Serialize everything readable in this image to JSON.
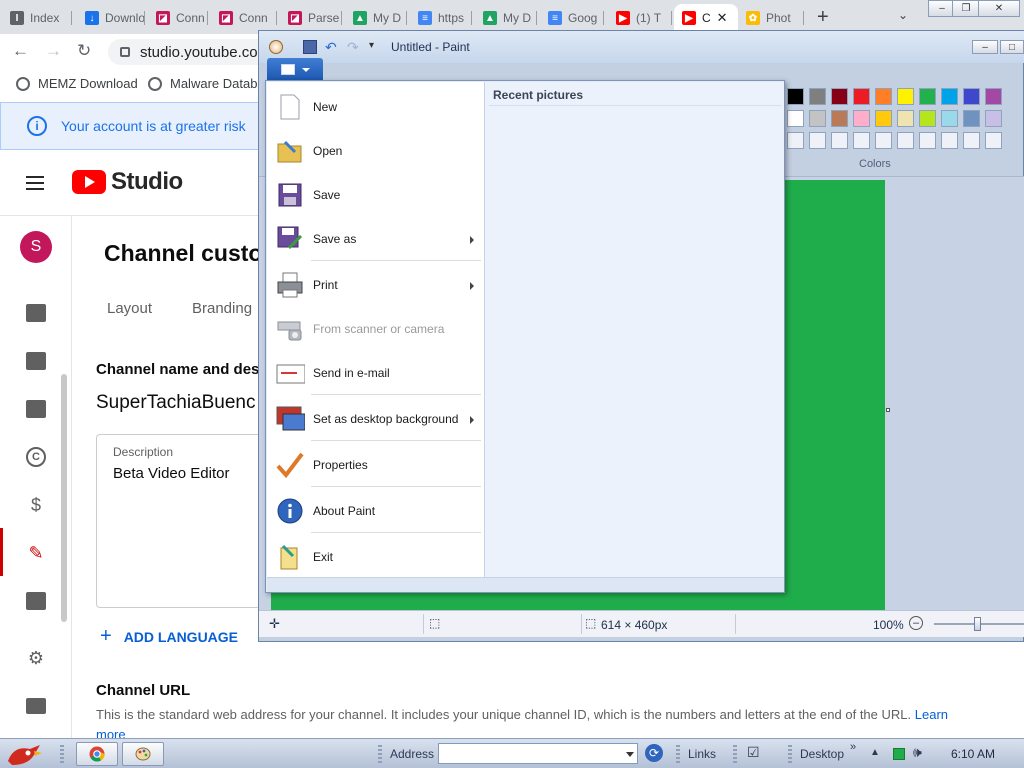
{
  "browser": {
    "tabs": [
      {
        "label": "Index",
        "fav": "I",
        "favColor": "#5f6368"
      },
      {
        "label": "Downloads",
        "fav": "↓",
        "favColor": "#1a73e8"
      },
      {
        "label": "Conn",
        "fav": "◪",
        "favColor": "#c2185b"
      },
      {
        "label": "Conn",
        "fav": "◪",
        "favColor": "#c2185b"
      },
      {
        "label": "Parse",
        "fav": "◪",
        "favColor": "#c2185b"
      },
      {
        "label": "My D",
        "fav": "▲",
        "favColor": "#1fa463"
      },
      {
        "label": "https",
        "fav": "≡",
        "favColor": "#4285f4"
      },
      {
        "label": "My D",
        "fav": "▲",
        "favColor": "#1fa463"
      },
      {
        "label": "Goog",
        "fav": "≡",
        "favColor": "#4285f4"
      },
      {
        "label": "(1) T",
        "fav": "▶",
        "favColor": "#ff0000"
      },
      {
        "label": "C",
        "fav": "▶",
        "favColor": "#ff0000"
      },
      {
        "label": "Phot",
        "fav": "✿",
        "favColor": "#fbbc04"
      }
    ],
    "new_tab": "+",
    "address": "studio.youtube.com",
    "bookmarks": [
      "MEMZ Download",
      "Malware Databas"
    ]
  },
  "youtube": {
    "banner": "Your account is at greater risk",
    "logo_text": "Studio",
    "avatar_letter": "S",
    "page_title": "Channel custom",
    "tabs": [
      "Layout",
      "Branding"
    ],
    "section_title": "Channel name and desc",
    "channel_name": "SuperTachiaBuenc",
    "description_label": "Description",
    "description_value": "Beta Video Editor",
    "add_language": "ADD LANGUAGE",
    "url_title": "Channel URL",
    "url_desc": "This is the standard web address for your channel. It includes your unique channel ID, which is the numbers and letters at the end of the URL.",
    "learn_more": "Learn more"
  },
  "paint": {
    "title": "Untitled - Paint",
    "colors_label": "Colors",
    "palette_row1": [
      "#000000",
      "#7f7f7f",
      "#880015",
      "#ed1c24",
      "#ff7f27",
      "#fff200",
      "#22b14c",
      "#00a2e8",
      "#3f48cc",
      "#a349a4"
    ],
    "palette_row2": [
      "#ffffff",
      "#c3c3c3",
      "#b97a57",
      "#ffaec9",
      "#ffc90e",
      "#efe4b0",
      "#b5e61d",
      "#99d9ea",
      "#7092be",
      "#c8bfe7"
    ],
    "canvas_color": "#1fad4b",
    "dimensions": "614 × 460px",
    "zoom": "100%",
    "menu": {
      "recent_label": "Recent pictures",
      "items": [
        {
          "label": "New",
          "icon": "new-doc-icon"
        },
        {
          "label": "Open",
          "icon": "folder-open-icon"
        },
        {
          "label": "Save",
          "icon": "floppy-disk-icon"
        },
        {
          "label": "Save as",
          "icon": "save-as-icon"
        },
        {
          "label": "Print",
          "icon": "printer-icon"
        },
        {
          "label": "From scanner or camera",
          "icon": "scanner-icon"
        },
        {
          "label": "Send in e-mail",
          "icon": "email-icon"
        },
        {
          "label": "Set as desktop background",
          "icon": "desktop-background-icon"
        },
        {
          "label": "Properties",
          "icon": "checkmark-icon"
        },
        {
          "label": "About Paint",
          "icon": "info-icon"
        },
        {
          "label": "Exit",
          "icon": "exit-icon"
        }
      ]
    }
  },
  "taskbar": {
    "address_label": "Address",
    "links_label": "Links",
    "desktop_label": "Desktop",
    "clock": "6:10 AM"
  }
}
